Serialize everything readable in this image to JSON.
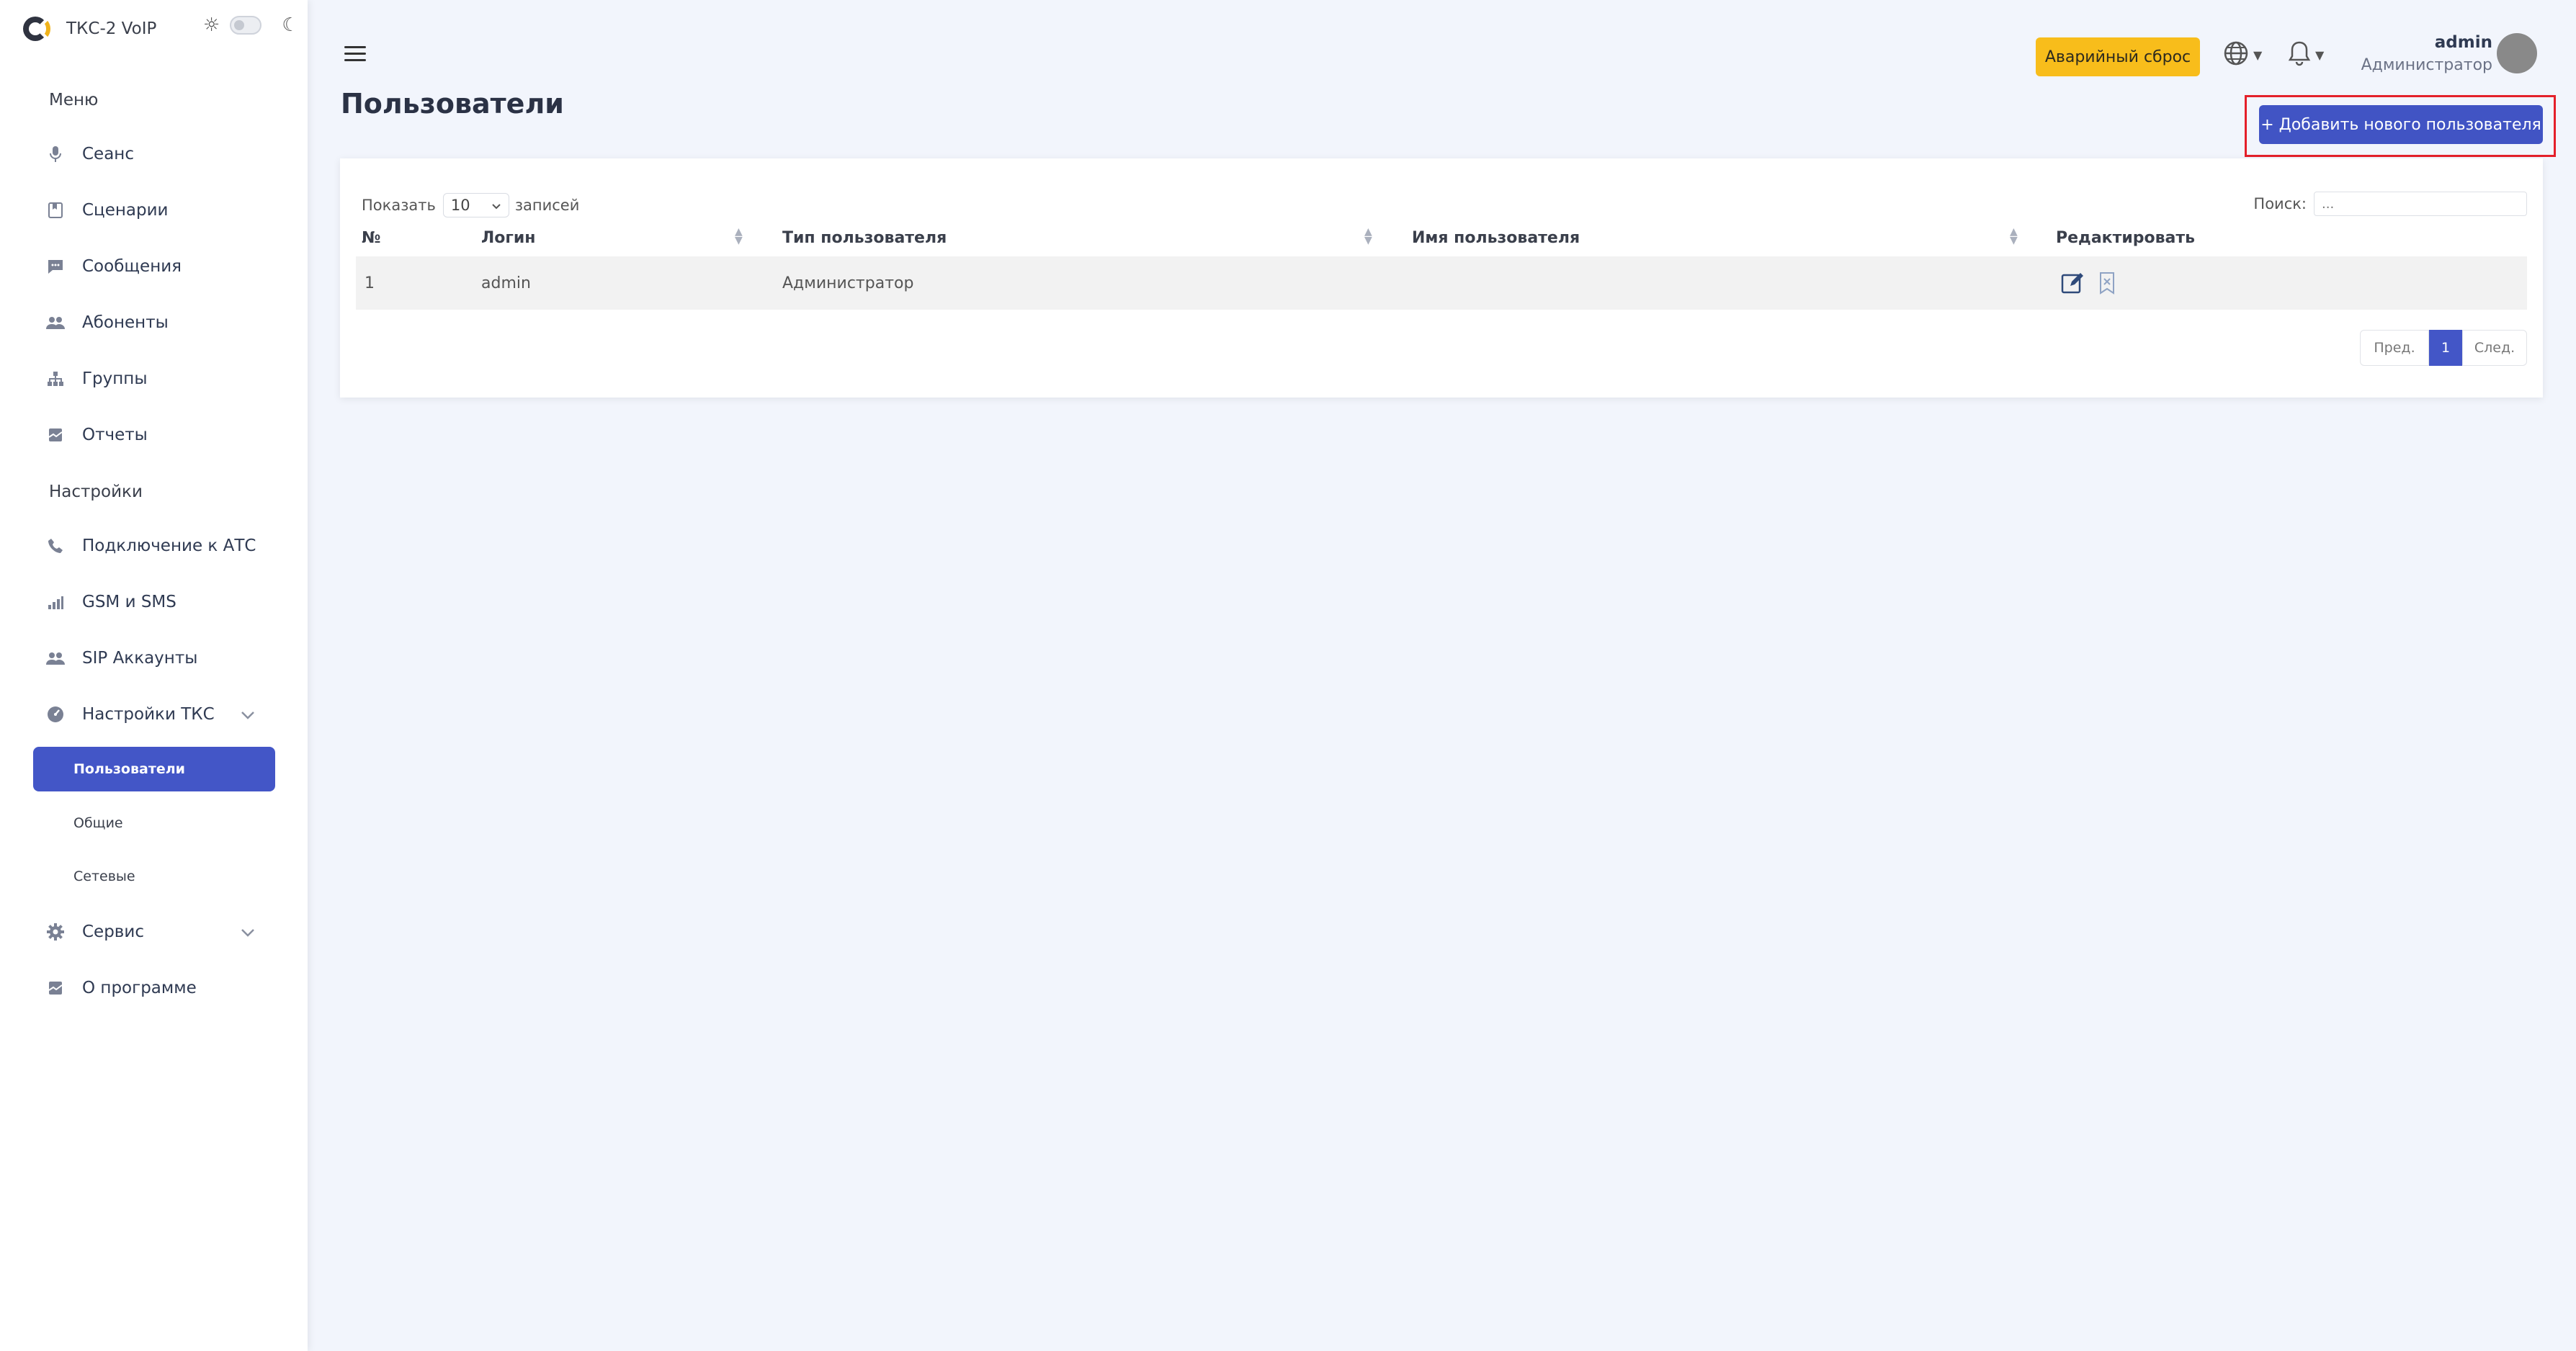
{
  "app": {
    "title": "ТКС-2 VoIP"
  },
  "sidebar": {
    "menu_label": "Меню",
    "menu_items": [
      {
        "label": "Сеанс",
        "icon": "microphone-icon"
      },
      {
        "label": "Сценарии",
        "icon": "bookmark-icon"
      },
      {
        "label": "Сообщения",
        "icon": "chat-icon"
      },
      {
        "label": "Абоненты",
        "icon": "users-icon"
      },
      {
        "label": "Группы",
        "icon": "hierarchy-icon"
      },
      {
        "label": "Отчеты",
        "icon": "report-icon"
      }
    ],
    "settings_label": "Настройки",
    "settings_items": [
      {
        "label": "Подключение к АТС",
        "icon": "phone-icon"
      },
      {
        "label": "GSM и SMS",
        "icon": "signal-icon"
      },
      {
        "label": "SIP Аккаунты",
        "icon": "users-icon"
      },
      {
        "label": "Настройки ТКС",
        "icon": "gauge-icon"
      }
    ],
    "tks_subitems": [
      "Пользователи",
      "Общие",
      "Сетевые"
    ],
    "service_label": "Сервис",
    "about_label": "О программе"
  },
  "header": {
    "emergency_label": "Аварийный сброс",
    "user": {
      "name": "admin",
      "role": "Администратор"
    }
  },
  "page": {
    "title": "Пользователи",
    "add_button": "+ Добавить нового пользователя"
  },
  "table": {
    "show_label": "Показать",
    "page_size": "10",
    "entries_label": "записей",
    "search_label": "Поиск:",
    "search_placeholder": "...",
    "columns": [
      "№",
      "Логин",
      "Тип пользователя",
      "Имя пользователя",
      "Редактировать"
    ],
    "rows": [
      {
        "num": "1",
        "login": "admin",
        "type": "Администратор",
        "name": ""
      }
    ],
    "pagination": {
      "prev": "Пред.",
      "current": "1",
      "next": "След."
    }
  },
  "colors": {
    "accent": "#4356c7",
    "warning": "#f8bd1b",
    "highlight": "#e4202a"
  }
}
